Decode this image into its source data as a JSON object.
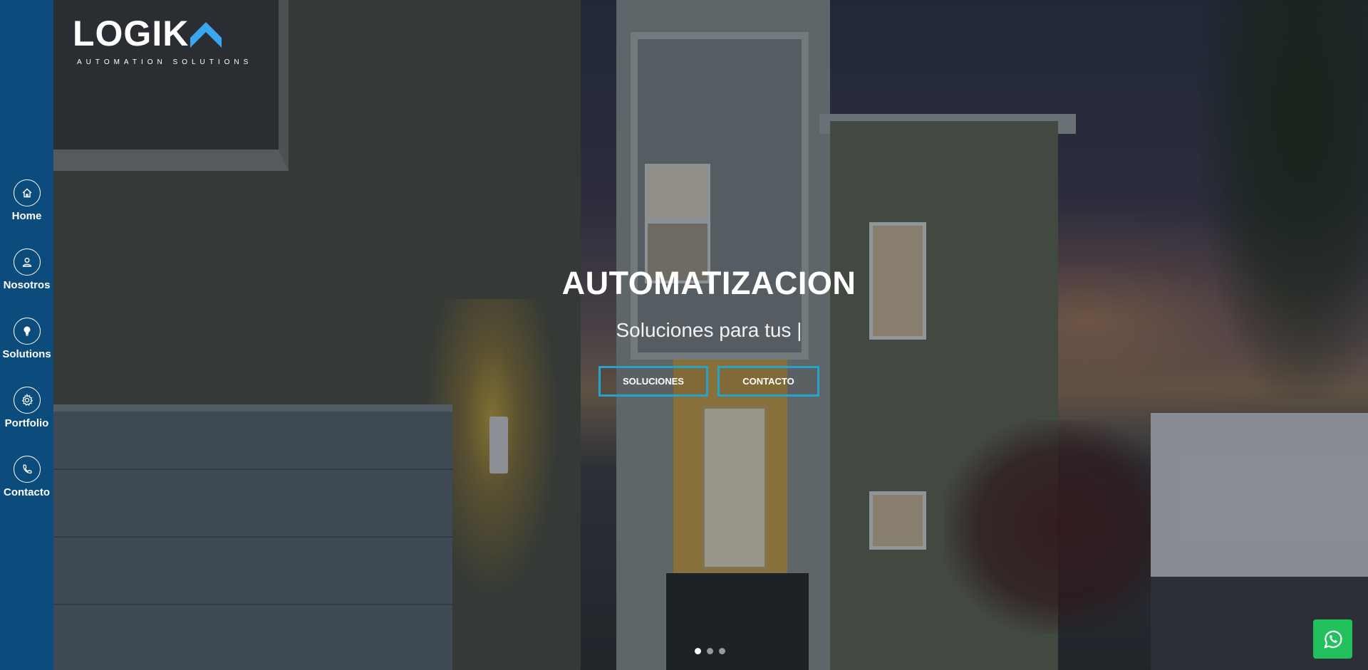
{
  "logo": {
    "name": "LOGIK",
    "tagline": "AUTOMATION SOLUTIONS",
    "accent_color": "#3aa6ef"
  },
  "sidebar": {
    "background": "#0c4c7d",
    "items": [
      {
        "label": "Home",
        "icon": "home-icon"
      },
      {
        "label": "Nosotros",
        "icon": "user-icon"
      },
      {
        "label": "Solutions",
        "icon": "lightbulb-icon"
      },
      {
        "label": "Portfolio",
        "icon": "gear-icon"
      },
      {
        "label": "Contacto",
        "icon": "phone-icon"
      }
    ]
  },
  "hero": {
    "title": "AUTOMATIZACION",
    "subtitle": "Soluciones para tus |",
    "buttons": {
      "soluciones": "SOLUCIONES",
      "contacto": "CONTACTO"
    },
    "button_border_color": "#25a3c8"
  },
  "carousel": {
    "slides": 3,
    "active_index": 0
  },
  "whatsapp": {
    "icon": "whatsapp-icon",
    "color": "#22c15e"
  }
}
